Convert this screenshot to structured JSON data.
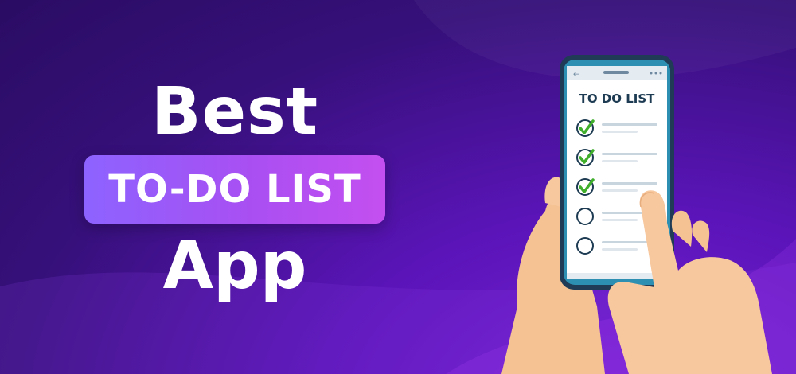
{
  "headline": {
    "line1": "Best",
    "highlight": "TO-DO LIST",
    "line3": "App"
  },
  "phone": {
    "screen_title": "TO DO LIST",
    "items": [
      {
        "checked": true
      },
      {
        "checked": true
      },
      {
        "checked": true
      },
      {
        "checked": false
      },
      {
        "checked": false
      }
    ]
  },
  "colors": {
    "background": "#36107a",
    "highlight_pill": "#a94ff2",
    "check": "#3fae2a",
    "skin": "#f7c79d"
  }
}
